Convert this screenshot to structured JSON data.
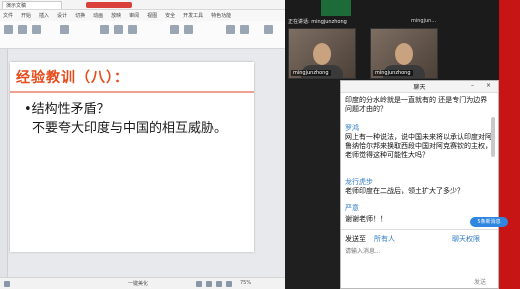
{
  "presentation": {
    "tab_label": "演示文稿",
    "menus": [
      "文件",
      "开始",
      "插入",
      "设计",
      "切换",
      "动画",
      "放映",
      "审阅",
      "视图",
      "安全",
      "开发工具",
      "特色功能"
    ],
    "slide": {
      "title": "经验教训（八）：",
      "bullet": "•结构性矛盾？",
      "line2": "不要夸大印度与中国的相互威胁。"
    },
    "status": {
      "notes": "一键美化",
      "zoom": "75%"
    }
  },
  "video": {
    "name_top_1": "正在讲话: mingjunzhong",
    "name_top_2": "mingjun...",
    "tile_1_label": "mingjunzhong",
    "tile_2_label": "mingjunzhong"
  },
  "chat": {
    "title": "聊天",
    "messages": [
      {
        "sender": "",
        "text": "印度的分水岭就是一直就有的 还是专门为边界问题才由的？"
      },
      {
        "sender": "罗鸿",
        "text": "网上有一种说法，说中国未来将以承认印度对阿鲁纳恰尔邦来换取西段中国对阿克赛钦的主权，老师觉得这种可能性大吗？"
      },
      {
        "sender": "龙行虎步",
        "text": "老师印度在二战后，领土扩大了多少？"
      },
      {
        "sender": "严意",
        "text": "谢谢老师！！"
      }
    ],
    "new_badge": "5条新消息",
    "send_to_label": "发送至",
    "send_to_value": "所有人",
    "permissions": "聊天权限",
    "input_placeholder": "请输入消息...",
    "send_label": "发送"
  },
  "colors": {
    "slide_title": "#e64b1a",
    "link_blue": "#2d7cc7",
    "red_strip": "#c71414"
  }
}
